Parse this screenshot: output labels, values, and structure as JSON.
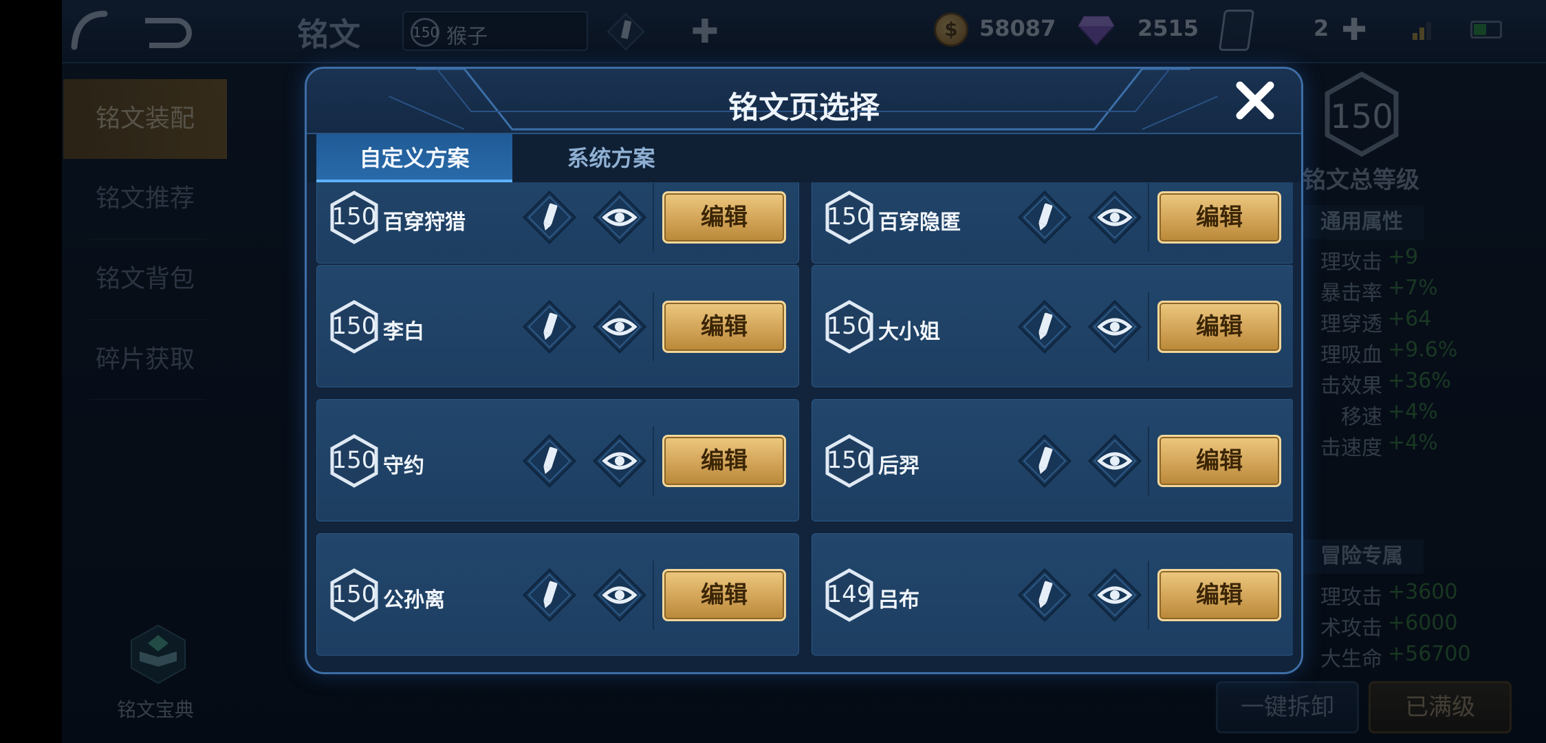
{
  "topbar": {
    "title": "铭文",
    "hero_level": "150",
    "hero_name": "猴子",
    "gold": "58087",
    "diamonds": "2515",
    "cards": "2"
  },
  "nav": {
    "items": [
      "铭文装配",
      "铭文推荐",
      "铭文背包",
      "碎片获取"
    ],
    "codex_label": "铭文宝典"
  },
  "right_panel": {
    "total_level": "150",
    "total_level_label": "铭文总等级",
    "general_header": "通用属性",
    "general_stats": [
      {
        "k": "理攻击",
        "v": "+9"
      },
      {
        "k": "暴击率",
        "v": "+7%"
      },
      {
        "k": "理穿透",
        "v": "+64"
      },
      {
        "k": "理吸血",
        "v": "+9.6%"
      },
      {
        "k": "击效果",
        "v": "+36%"
      },
      {
        "k": "移速",
        "v": "+4%"
      },
      {
        "k": "击速度",
        "v": "+4%"
      }
    ],
    "adventure_header": "冒险专属",
    "adventure_stats": [
      {
        "k": "理攻击",
        "v": "+3600"
      },
      {
        "k": "术攻击",
        "v": "+6000"
      },
      {
        "k": "大生命",
        "v": "+56700"
      }
    ],
    "btn_unload": "一键拆卸",
    "btn_maxed": "已满级"
  },
  "modal": {
    "title": "铭文页选择",
    "tabs": [
      "自定义方案",
      "系统方案"
    ],
    "edit_label": "编辑",
    "pages": [
      {
        "level": "150",
        "name": "百穿狩猎"
      },
      {
        "level": "150",
        "name": "百穿隐匿"
      },
      {
        "level": "150",
        "name": "李白"
      },
      {
        "level": "150",
        "name": "大小姐"
      },
      {
        "level": "150",
        "name": "守约"
      },
      {
        "level": "150",
        "name": "后羿"
      },
      {
        "level": "150",
        "name": "公孙离"
      },
      {
        "level": "149",
        "name": "吕布"
      }
    ]
  }
}
